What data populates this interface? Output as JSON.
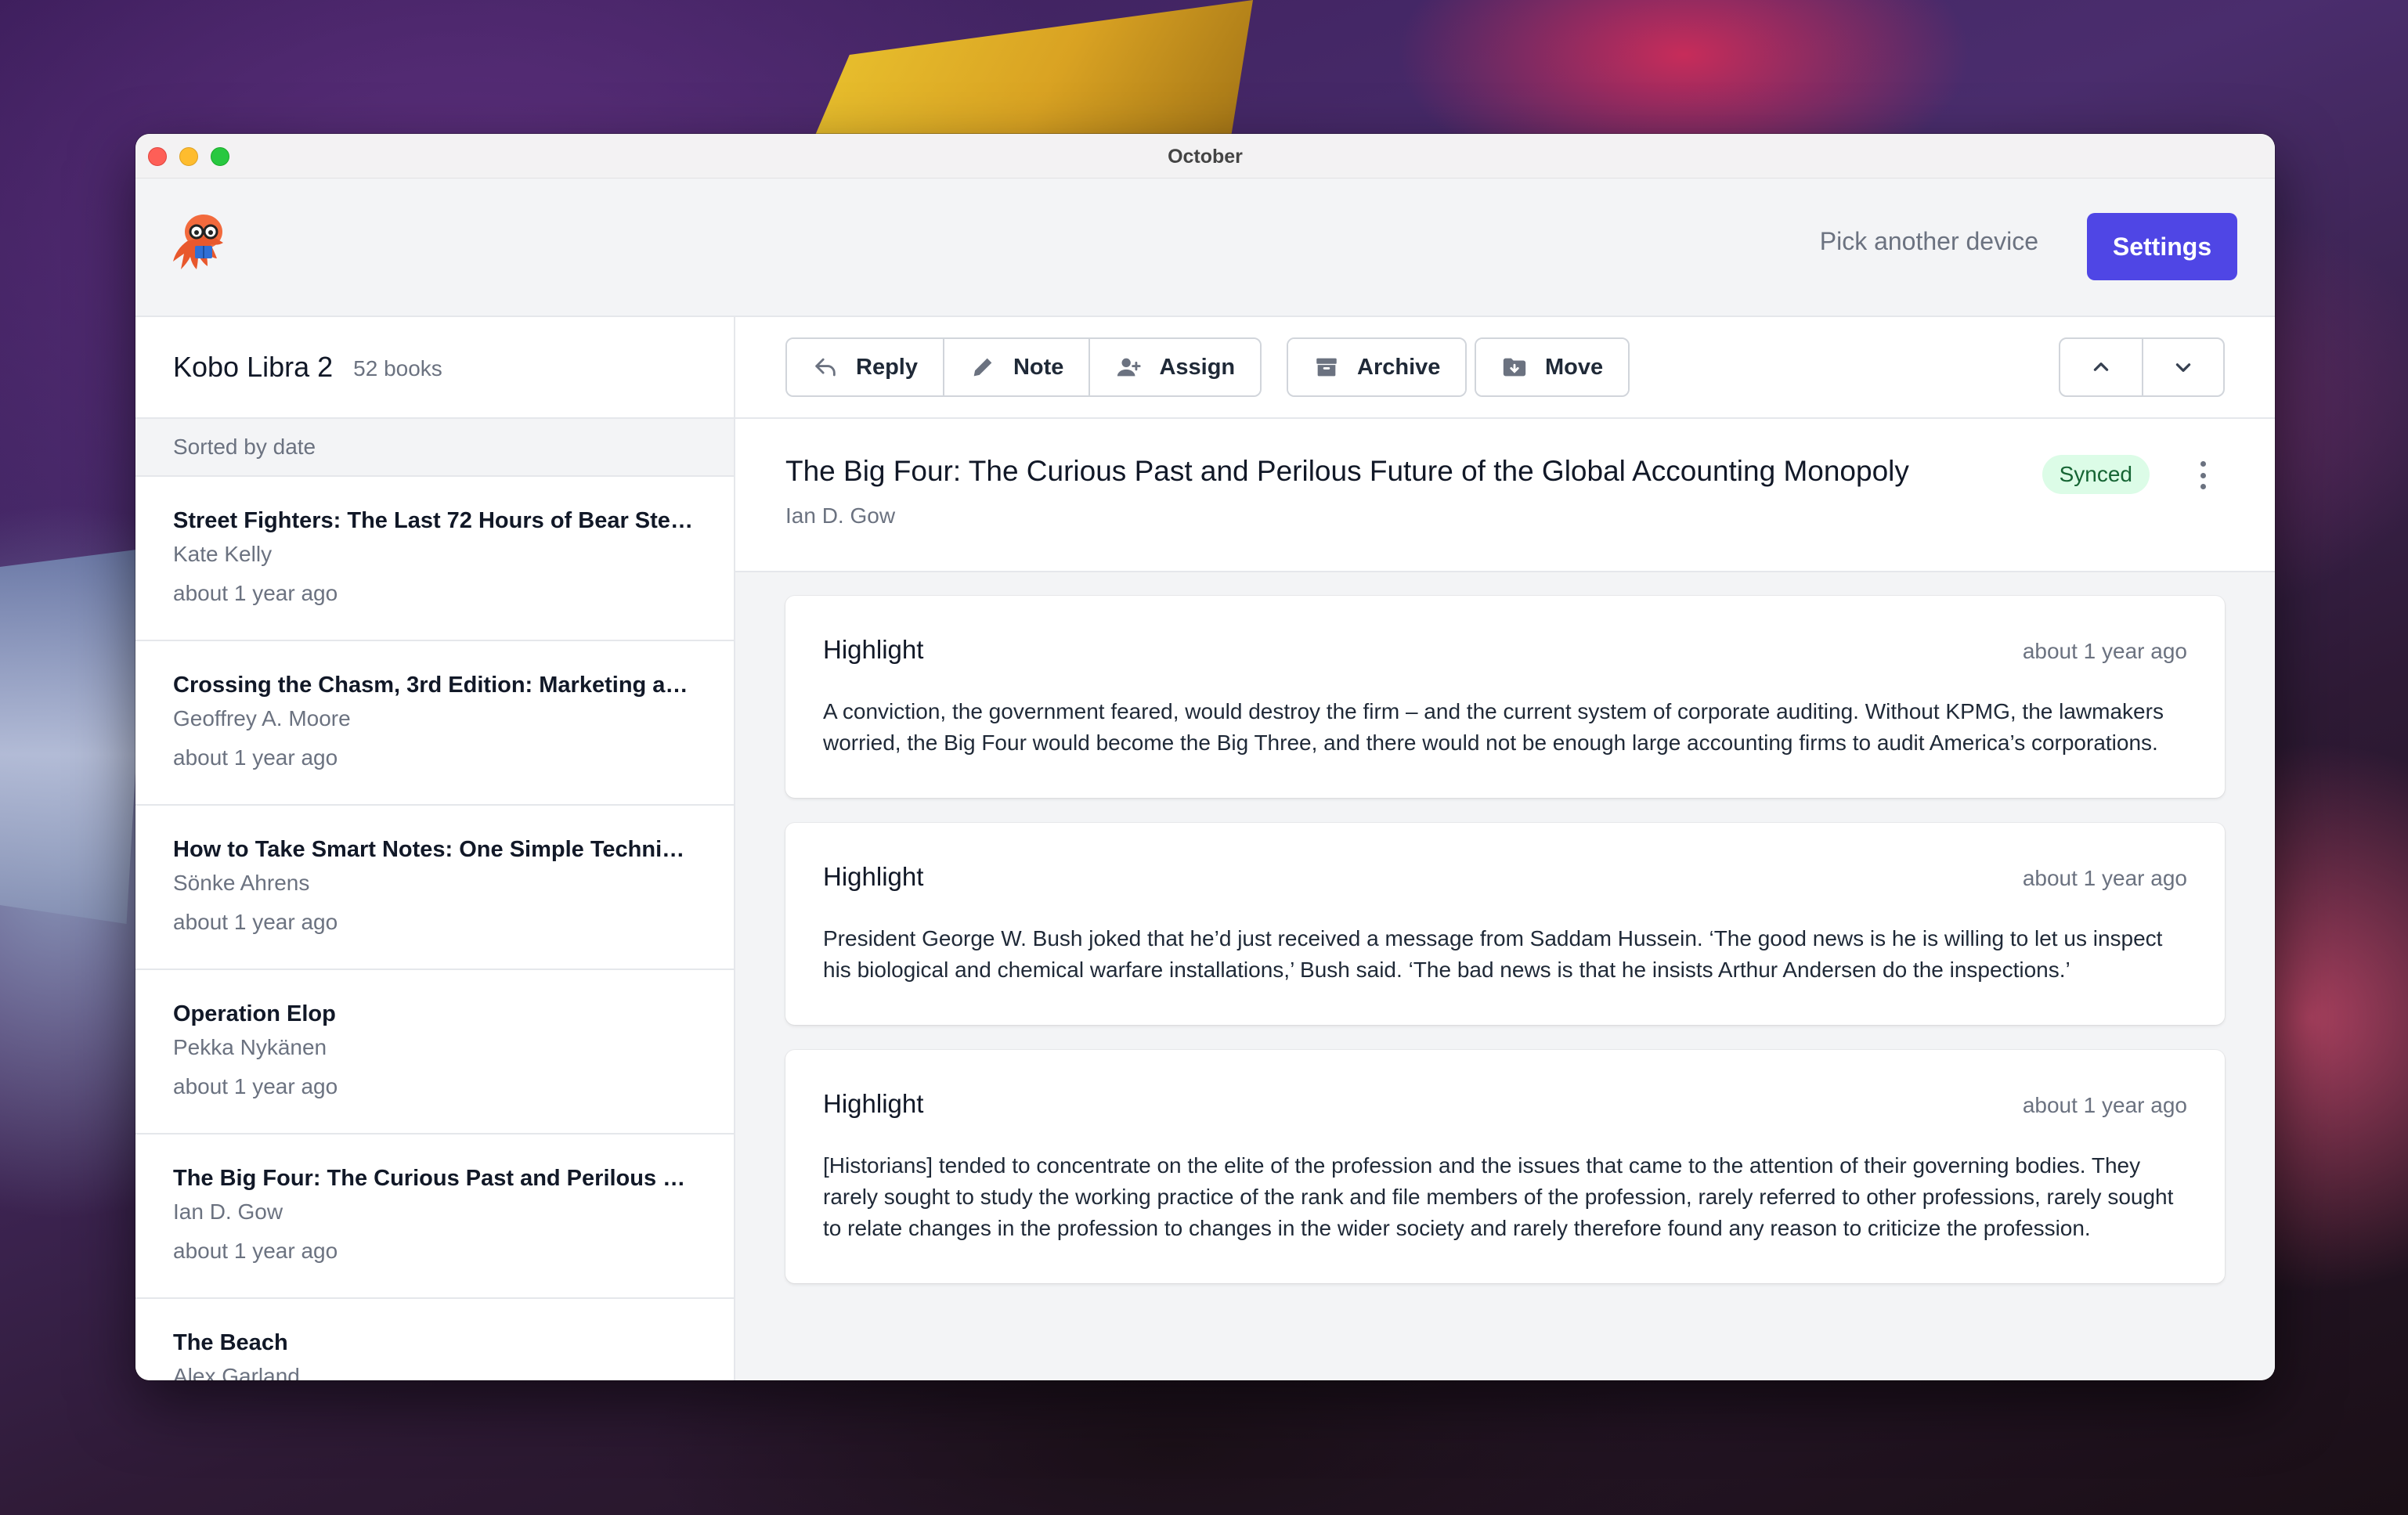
{
  "window": {
    "title": "October"
  },
  "header": {
    "pick_device_label": "Pick another device",
    "settings_label": "Settings",
    "accent_color": "#4f46e5"
  },
  "sidebar": {
    "device_name": "Kobo Libra 2",
    "book_count": "52 books",
    "sort_label": "Sorted by date",
    "books": [
      {
        "title": "Street Fighters: The Last 72 Hours of Bear Stear...",
        "author": "Kate Kelly",
        "time": "about 1 year ago"
      },
      {
        "title": "Crossing the Chasm, 3rd Edition: Marketing and ...",
        "author": "Geoffrey A. Moore",
        "time": "about 1 year ago"
      },
      {
        "title": "How to Take Smart Notes: One Simple Technique...",
        "author": "Sönke Ahrens",
        "time": "about 1 year ago"
      },
      {
        "title": "Operation Elop",
        "author": "Pekka Nykänen",
        "time": "about 1 year ago"
      },
      {
        "title": "The Big Four: The Curious Past and Perilous Futu...",
        "author": "Ian D. Gow",
        "time": "about 1 year ago"
      },
      {
        "title": "The Beach",
        "author": "Alex Garland",
        "time": ""
      }
    ]
  },
  "toolbar": {
    "reply_label": "Reply",
    "note_label": "Note",
    "assign_label": "Assign",
    "archive_label": "Archive",
    "move_label": "Move"
  },
  "book": {
    "title": "The Big Four: The Curious Past and Perilous Future of the Global Accounting Monopoly",
    "author": "Ian D. Gow",
    "status": "Synced"
  },
  "highlights": [
    {
      "label": "Highlight",
      "time": "about 1 year ago",
      "text": "A conviction, the government feared, would destroy the firm – and the current system of corporate auditing. Without KPMG, the lawmakers worried, the Big Four would become the Big Three, and there would not be enough large accounting firms to audit America’s corporations."
    },
    {
      "label": "Highlight",
      "time": "about 1 year ago",
      "text": "President George W. Bush joked that he’d just received a message from Saddam Hussein. ‘The good news is he is willing to let us inspect his biological and chemical warfare installations,’ Bush said. ‘The bad news is that he insists Arthur Andersen do the inspections.’"
    },
    {
      "label": "Highlight",
      "time": "about 1 year ago",
      "text": "[Historians] tended to concentrate on the elite of the profession and the issues that came to the attention of their governing bodies. They rarely sought to study the working practice of the rank and file members of the profession, rarely referred to other professions, rarely sought to relate changes in the profession to changes in the wider society and rarely therefore found any reason to criticize the profession."
    }
  ]
}
